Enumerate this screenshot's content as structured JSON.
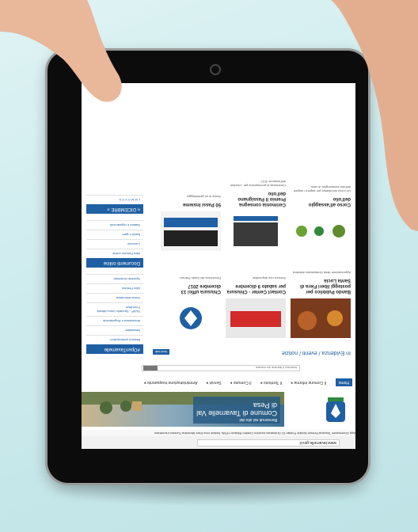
{
  "photo": {
    "description_tags": [
      "hands-holding-tablet",
      "rotated-website"
    ]
  },
  "browser": {
    "url": "www.tavarnelle.gov.it",
    "bookmarks": "App  Governance Toscana  Firenze Notizie Portale 01  Ordinanza incontro Cimiteri  Rilascio HTML Notizie  Inno Esec Mecidina  Turismo incontrano"
  },
  "header": {
    "banner_greeting": "Benvenuti nel sito del",
    "banner_title": "Comune di Tavarnelle Val di Pesa"
  },
  "nav": {
    "home": "Home",
    "items": [
      "Il Comune informa ▾",
      "Il Territorio ▾",
      "Il Comune ▾",
      "Servizi ▾",
      "Amministrazione trasparente ▾"
    ]
  },
  "search": {
    "placeholder": "Inserisci il termine da cercare",
    "button": "Cerca"
  },
  "sidebar": {
    "head": "#OpenTavarnelle",
    "items": [
      "Bilancio partecipativo",
      "Newsletter",
      "Modulistica e Regolamenti",
      "SUAP - Sportello Unico Attività Produttive",
      "Guida telematica",
      "Albo Pretorio",
      "Sportello Ambiente"
    ]
  },
  "evidenza": {
    "title": "In Evidenza / eventi / notizie",
    "vedi": "Vedi tutti"
  },
  "cards": [
    {
      "title": "Chiusura uffici 13 dicembre 2017",
      "desc": "Ricorrenza del Santo Patrono"
    },
    {
      "title": "Contact Center - Chiusura per sabato 9 dicembre",
      "desc": "Servizio non disponibile"
    },
    {
      "title": "Bando Pubblico per posteggi liberi Fiera di Santa Lucia",
      "desc": "Approvazione della Graduatoria definitiva"
    },
    {
      "title": "50 Passi Insieme",
      "desc": "Stona di un gemellaggio"
    },
    {
      "title": "Cerimonia consegna Premio Il Passignano dell'olio",
      "desc": "Ceremonia di premiazione per i vincitori dell'edizione 2017"
    },
    {
      "title": "Corso all'assaggio dell'olio",
      "desc": "Un corso introduttivo per sapere i segreti dell'olio extravergine di oliva"
    }
  ],
  "documenti": {
    "head": "Documenti online",
    "items": [
      "Albo Pretorio online",
      "Concorsi",
      "Bandi e gare",
      "Statuto e regolamenti"
    ]
  },
  "calendar": {
    "head": "« DICEMBRE »",
    "days": "L M M G V S D"
  },
  "colors": {
    "brand": "#1f5fa3",
    "accent": "#e07b1f"
  }
}
